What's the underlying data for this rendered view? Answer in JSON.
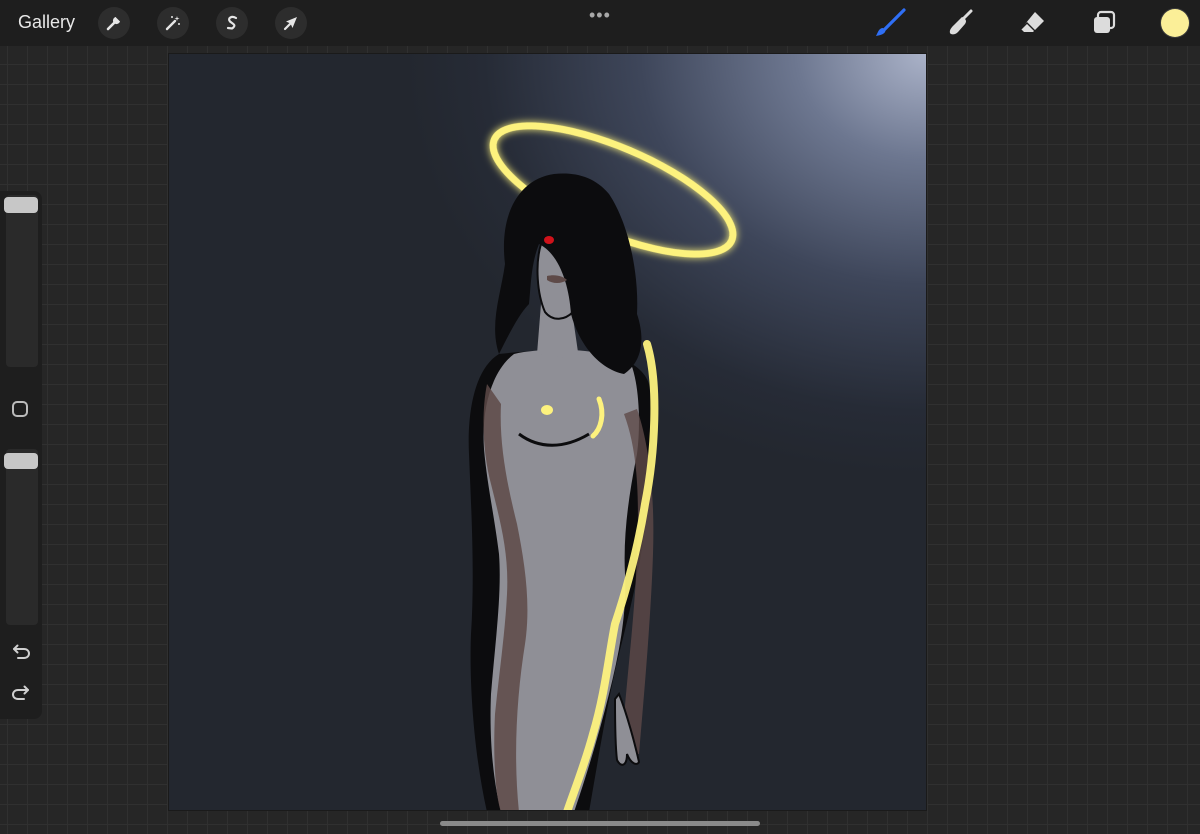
{
  "topbar": {
    "gallery_label": "Gallery",
    "left_tools": [
      {
        "name": "actions",
        "icon": "wrench-icon"
      },
      {
        "name": "adjustments",
        "icon": "magic-wand-icon"
      },
      {
        "name": "selection",
        "icon": "selection-s-icon"
      },
      {
        "name": "transform",
        "icon": "arrow-cursor-icon"
      }
    ],
    "more_label": "•••",
    "right_tools": [
      {
        "name": "brush",
        "icon": "brush-icon",
        "active": true
      },
      {
        "name": "smudge",
        "icon": "smudge-icon"
      },
      {
        "name": "eraser",
        "icon": "eraser-icon"
      },
      {
        "name": "layers",
        "icon": "layers-icon"
      }
    ],
    "current_color": "#fbef98"
  },
  "sidebar": {
    "brush_size_level": 0.95,
    "opacity_level": 0.95,
    "modify_icon": "square-icon",
    "undo_icon": "undo-icon",
    "redo_icon": "redo-icon"
  },
  "canvas": {
    "background_color": "#23272f",
    "light_color": "#aab2c8",
    "halo_color": "#fdf27e",
    "skin_color": "#8f8f96",
    "shadow_color": "#5e4a48",
    "hair_color": "#0c0c0e",
    "eye_color": "#d0121a"
  },
  "colors": {
    "accent": "#2f6ff5",
    "toolbar_bg": "#1e1e1e"
  }
}
